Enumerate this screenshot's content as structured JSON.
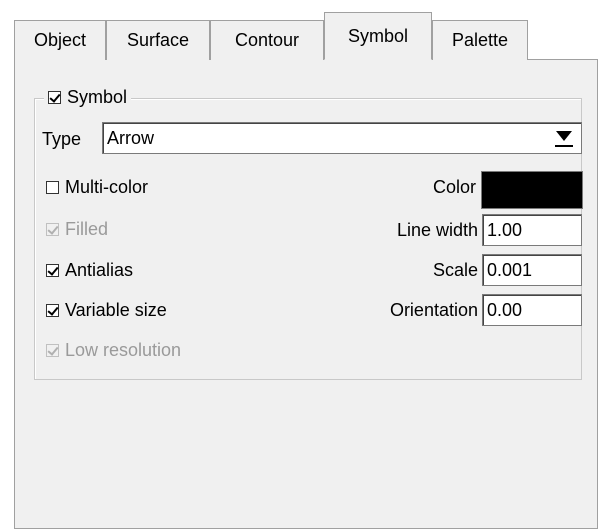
{
  "tabs": [
    {
      "label": "Object"
    },
    {
      "label": "Surface"
    },
    {
      "label": "Contour"
    },
    {
      "label": "Symbol",
      "active": true
    },
    {
      "label": "Palette"
    }
  ],
  "symbol_group": {
    "label": "Symbol",
    "checked": true
  },
  "type": {
    "label": "Type",
    "value": "Arrow"
  },
  "options": {
    "multi_color": {
      "label": "Multi-color",
      "checked": false
    },
    "filled": {
      "label": "Filled",
      "checked": true,
      "disabled": true
    },
    "antialias": {
      "label": "Antialias",
      "checked": true
    },
    "variable_size": {
      "label": "Variable size",
      "checked": true
    },
    "low_resolution": {
      "label": "Low resolution",
      "checked": true,
      "disabled": true
    }
  },
  "fields": {
    "color": {
      "label": "Color",
      "value": "#000000"
    },
    "line_width": {
      "label": "Line width",
      "value": "1.00"
    },
    "scale": {
      "label": "Scale",
      "value": "0.001"
    },
    "orientation": {
      "label": "Orientation",
      "value": "0.00"
    }
  }
}
